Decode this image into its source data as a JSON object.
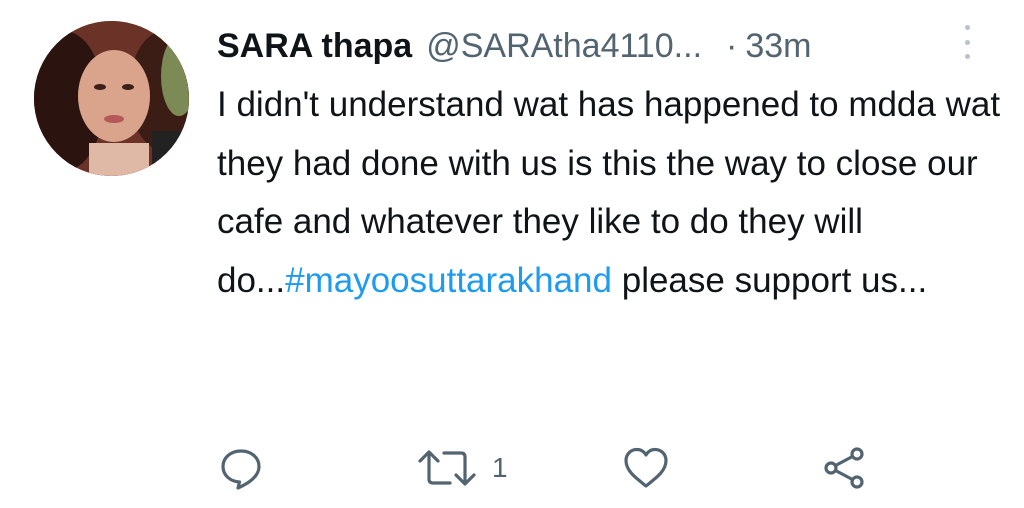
{
  "tweet": {
    "display_name": "SARA thapa",
    "handle": "@SARAtha4110...",
    "separator": "·",
    "time": "33m",
    "text_before": "I didn't understand wat has happened to mdda wat they had done with us is this the way to close our cafe and whatever they like to do they will do...",
    "hashtag": "#mayoosuttarakhand",
    "text_after": " please support us...",
    "retweet_count": "1"
  },
  "colors": {
    "text": "#0f1419",
    "secondary": "#536471",
    "link": "#1d9bf0",
    "icon": "#536471"
  },
  "icons": {
    "reply": "reply-icon",
    "retweet": "retweet-icon",
    "like": "heart-icon",
    "share": "share-icon",
    "more": "more-vertical-icon"
  }
}
